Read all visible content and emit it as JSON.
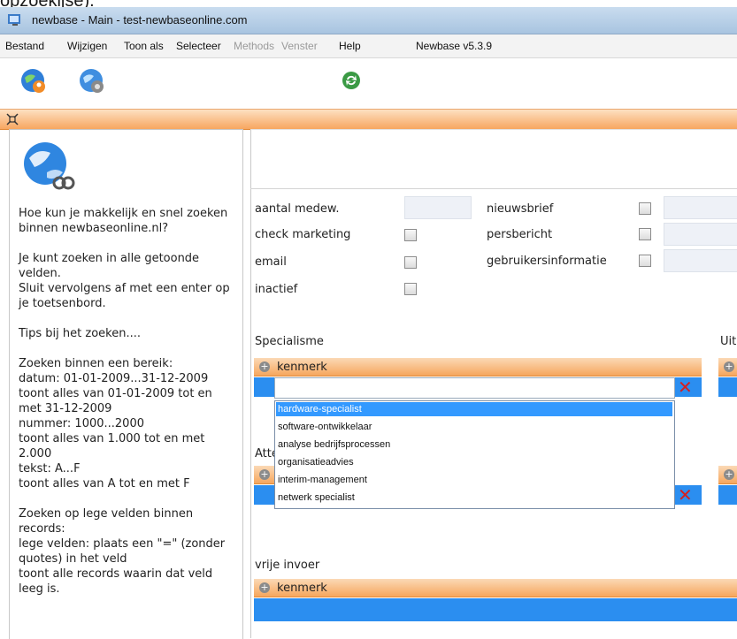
{
  "window": {
    "caption_fragment": "opzoekijse).",
    "title": "newbase - Main - test-newbaseonline.com"
  },
  "menu": {
    "items": [
      {
        "label": "Bestand",
        "enabled": true
      },
      {
        "label": "Wijzigen",
        "enabled": true
      },
      {
        "label": "Toon als",
        "enabled": true
      },
      {
        "label": "Selecteer",
        "enabled": true
      },
      {
        "label": "Methods",
        "enabled": false
      },
      {
        "label": "Venster",
        "enabled": false
      },
      {
        "label": "Help",
        "enabled": true
      }
    ],
    "version": "Newbase v5.3.9"
  },
  "toolbar": {
    "buttons": [
      {
        "icon": "globe-user-icon"
      },
      {
        "icon": "globe-settings-icon"
      },
      {
        "icon": "refresh-icon"
      }
    ]
  },
  "sidebar": {
    "help_text": "Hoe kun je makkelijk en snel zoeken binnen newbaseonline.nl?\n\nJe kunt zoeken in alle getoonde velden.\nSluit vervolgens af met een enter op je toetsenbord.\n\nTips bij het zoeken....\n\nZoeken binnen een bereik:\ndatum: 01-01-2009...31-12-2009\ntoont alles van 01-01-2009 tot en met 31-12-2009\nnummer: 1000...2000\ntoont alles van 1.000 tot en met 2.000\ntekst: A...F\ntoont alles van A tot en met F\n\nZoeken op lege velden binnen records:\nlege velden: plaats een \"=\" (zonder quotes) in het veld\ntoont alle records waarin dat veld leeg is."
  },
  "form": {
    "fields": {
      "aantal_medew": "aantal medew.",
      "check_marketing": "check marketing",
      "email": "email",
      "inactief": "inactief",
      "nieuwsbrief": "nieuwsbrief",
      "persbericht": "persbericht",
      "gebruikersinformatie": "gebruikersinformatie"
    }
  },
  "sections": {
    "specialisme": "Specialisme",
    "uit_fragment": "Uit",
    "atte_fragment": "Atte",
    "vrije_invoer": "vrije invoer",
    "kenmerk_header": "kenmerk"
  },
  "dropdown": {
    "options": [
      "hardware-specialist",
      "software-ontwikkelaar",
      "analyse bedrijfsprocessen",
      "organisatieadvies",
      "interim-management",
      "netwerk specialist"
    ],
    "selected_index": 0
  },
  "colors": {
    "accent_orange": "#f6a65d",
    "selection_blue": "#3399ff",
    "row_blue": "#2b8ef0",
    "delete_red": "#d42020"
  }
}
